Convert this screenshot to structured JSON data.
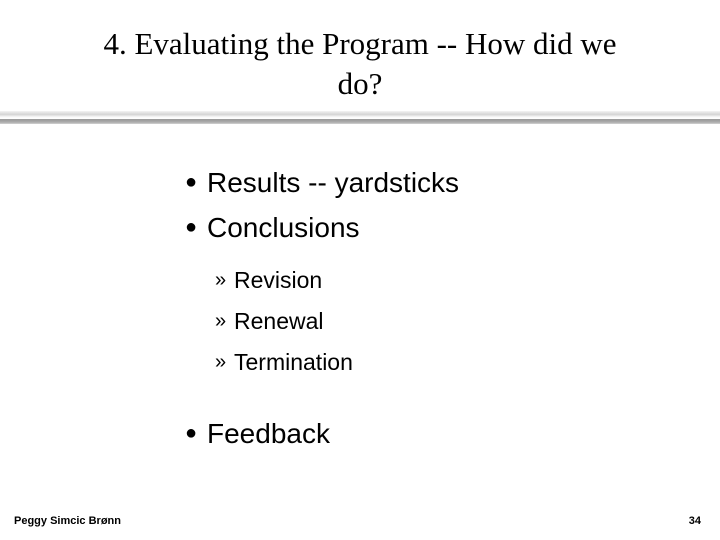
{
  "slide": {
    "background_color": "#ffffff",
    "text_color": "#000000",
    "title": {
      "line1": "4. Evaluating the Program -- How did we",
      "line2": "do?",
      "full": "4. Evaluating the Program -- How did we do?"
    },
    "divider": {
      "light_color": "#d4d4d4",
      "dark_color": "#9a9a9a"
    },
    "body": {
      "bullet_marker": "●",
      "sub_bullet_marker": "»",
      "items": [
        {
          "level": 1,
          "text": "Results -- yardsticks"
        },
        {
          "level": 1,
          "text": "Conclusions"
        },
        {
          "level": 2,
          "text": "Revision"
        },
        {
          "level": 2,
          "text": "Renewal"
        },
        {
          "level": 2,
          "text": "Termination"
        },
        {
          "level": 1,
          "text": "Feedback"
        }
      ]
    },
    "footer": {
      "author": "Peggy Simcic Brønn",
      "page_number": "34"
    }
  }
}
